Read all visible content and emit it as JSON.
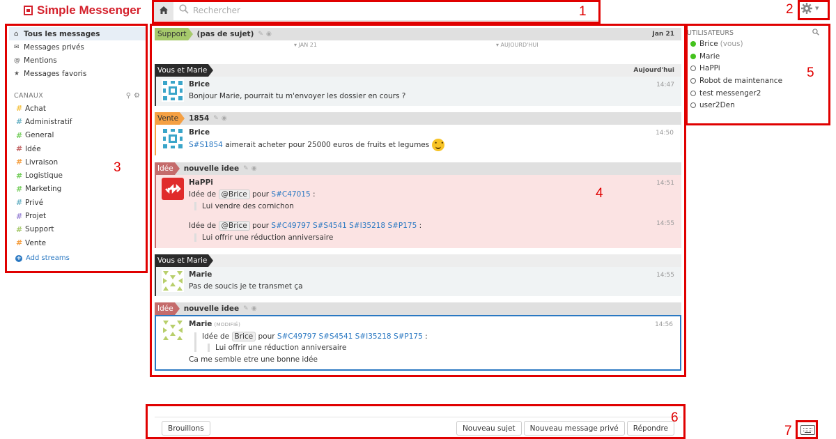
{
  "app": {
    "title": "Simple Messenger"
  },
  "topbar": {
    "search_placeholder": "Rechercher"
  },
  "callouts": [
    "1",
    "2",
    "3",
    "4",
    "5",
    "6",
    "7"
  ],
  "nav": [
    {
      "label": "Tous les messages",
      "icon": "home-icon",
      "glyph": "⌂"
    },
    {
      "label": "Messages privés",
      "icon": "envelope-icon",
      "glyph": "✉"
    },
    {
      "label": "Mentions",
      "icon": "at-icon",
      "glyph": "@"
    },
    {
      "label": "Messages favoris",
      "icon": "star-icon",
      "glyph": "★"
    }
  ],
  "streams_header": "CANAUX",
  "streams": [
    {
      "name": "Achat",
      "color": "#f5c343"
    },
    {
      "name": "Administratif",
      "color": "#6bb3c5"
    },
    {
      "name": "General",
      "color": "#76ce5d"
    },
    {
      "name": "Idée",
      "color": "#c56b6b"
    },
    {
      "name": "Livraison",
      "color": "#f5a043"
    },
    {
      "name": "Logistique",
      "color": "#76ce5d"
    },
    {
      "name": "Marketing",
      "color": "#76ce5d"
    },
    {
      "name": "Privé",
      "color": "#6bb3c5"
    },
    {
      "name": "Projet",
      "color": "#9b86d6"
    },
    {
      "name": "Support",
      "color": "#a6c96b"
    },
    {
      "name": "Vente",
      "color": "#f5a043"
    }
  ],
  "add_streams": "Add streams",
  "messages": {
    "r1": {
      "stream": "Support",
      "topic": "(pas de sujet)",
      "date": "Jan 21",
      "color": "#a6c96b"
    },
    "sep": {
      "left": "▾ JAN 21",
      "right": "▾ AUJOURD'HUI"
    },
    "r2": {
      "label": "Vous et Marie",
      "date": "Aujourd'hui",
      "m1": {
        "sender": "Brice",
        "time": "14:47",
        "text": "Bonjour Marie, pourrait tu m'envoyer les dossier en cours ?"
      }
    },
    "r3": {
      "stream": "Vente",
      "topic": "1854",
      "color": "#f5a043",
      "m1": {
        "sender": "Brice",
        "time": "14:50",
        "link": "S#S1854",
        "text": " aimerait acheter pour 25000 euros de fruits et legumes"
      }
    },
    "r4": {
      "stream": "Idée",
      "topic": "nouvelle idee",
      "color": "#c56b6b",
      "m1": {
        "sender": "HaPPi",
        "time": "14:51",
        "pre": "Idée de",
        "mention": "@Brice",
        "pour": "pour",
        "links": "S#C47015",
        "colon": ":",
        "quote": "Lui vendre des cornichon"
      },
      "m2": {
        "time": "14:55",
        "pre": "Idée de",
        "mention": "@Brice",
        "pour": "pour",
        "links": "S#C49797 S#S4541 S#I35218 S#P175",
        "colon": ":",
        "quote": "Lui offrir une réduction anniversaire"
      }
    },
    "r5": {
      "label": "Vous et Marie",
      "m1": {
        "sender": "Marie",
        "time": "14:55",
        "text": "Pas de soucis je te transmet ça"
      }
    },
    "r6": {
      "stream": "Idée",
      "topic": "nouvelle idee",
      "color": "#c56b6b",
      "m1": {
        "sender": "Marie",
        "edited": "(MODIFIÉ)",
        "time": "14:56",
        "pre": "Idée de",
        "mention": "Brice",
        "pour": "pour",
        "links": "S#C49797 S#S4541 S#I35218 S#P175",
        "colon": ":",
        "quote": "Lui offrir une réduction anniversaire",
        "text": "Ca me semble etre une bonne idée"
      }
    }
  },
  "users_header": "UTILISATEURS",
  "users": [
    {
      "name": "Brice",
      "suffix": "(vous)",
      "status": "on"
    },
    {
      "name": "Marie",
      "suffix": "",
      "status": "on"
    },
    {
      "name": "HaPPi",
      "suffix": "",
      "status": "off"
    },
    {
      "name": "Robot de maintenance",
      "suffix": "",
      "status": "off"
    },
    {
      "name": "test messenger2",
      "suffix": "",
      "status": "off"
    },
    {
      "name": "user2Den",
      "suffix": "",
      "status": "off"
    }
  ],
  "compose": {
    "drafts": "Brouillons",
    "new_topic": "Nouveau sujet",
    "new_pm": "Nouveau message privé",
    "reply": "Répondre"
  },
  "colors": {
    "accent": "#2a78c2",
    "annotation": "#e00000",
    "idea_bg": "#fbe3e3",
    "pm_bg": "#f0f3f4",
    "selected_border": "#2a78c2"
  }
}
